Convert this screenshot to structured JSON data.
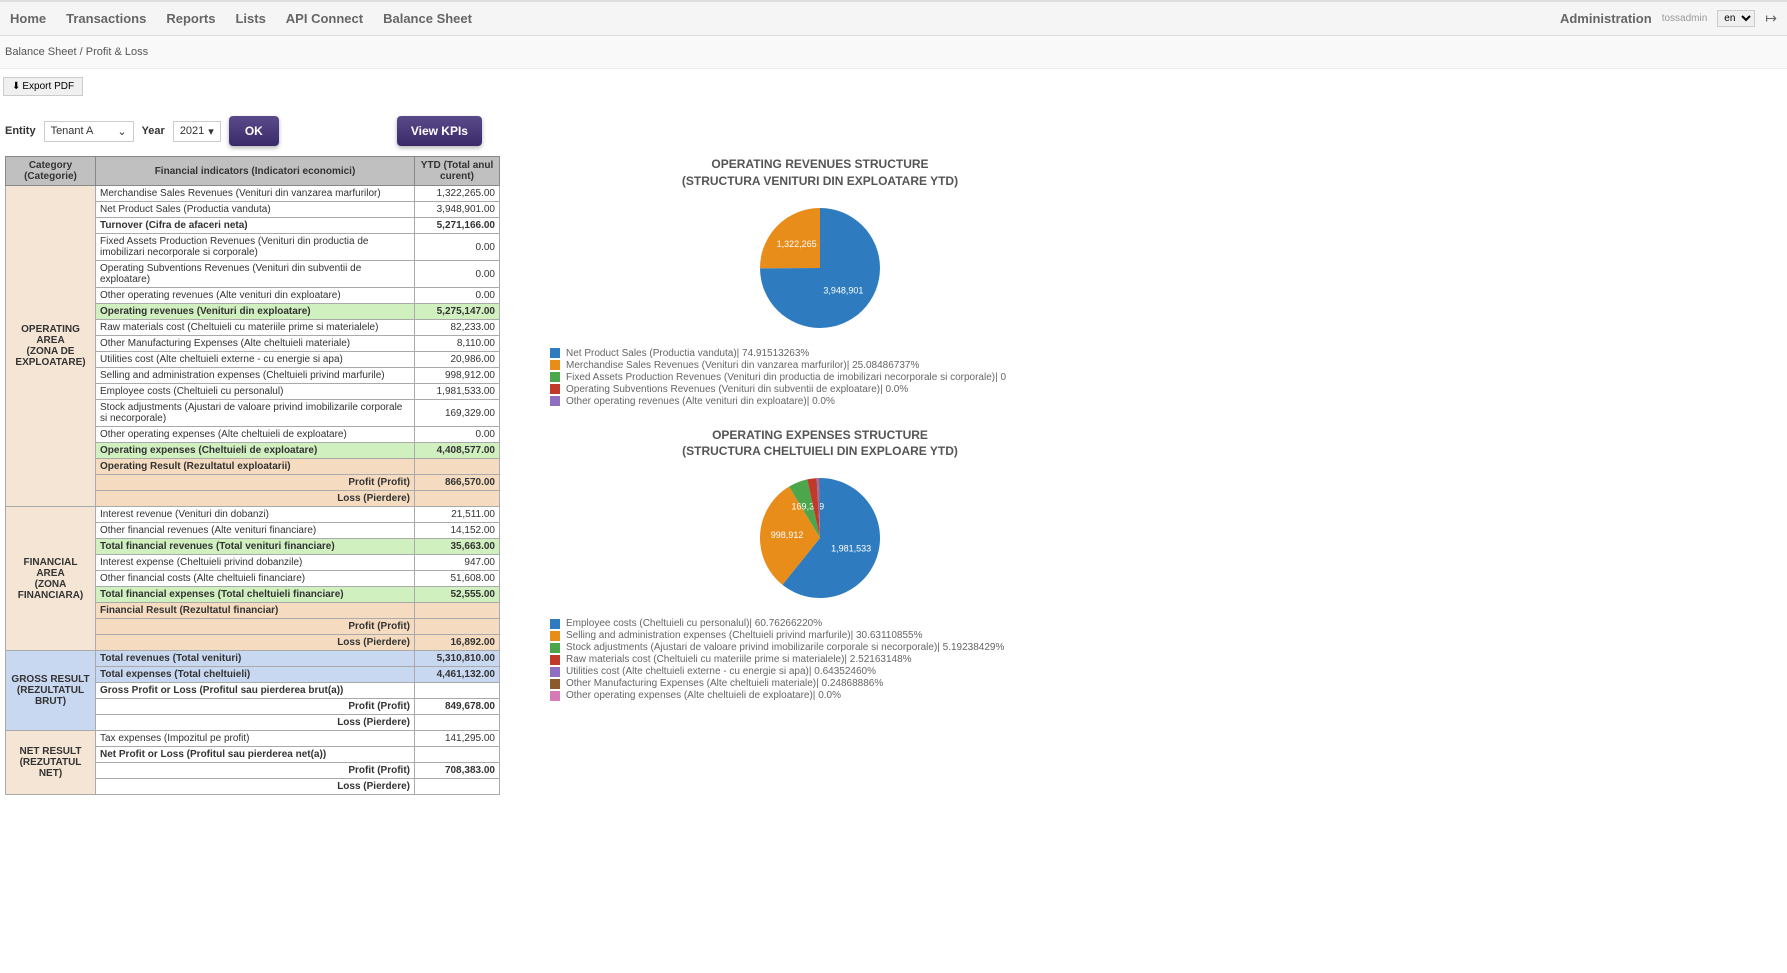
{
  "nav": {
    "items": [
      "Home",
      "Transactions",
      "Reports",
      "Lists",
      "API Connect",
      "Balance Sheet"
    ],
    "admin": "Administration",
    "user": "tossadmin",
    "lang": "en"
  },
  "breadcrumb": {
    "a": "Balance Sheet",
    "sep": " / ",
    "b": "Profit & Loss"
  },
  "export_label": "Export PDF",
  "controls": {
    "entity_label": "Entity",
    "entity_value": "Tenant A",
    "year_label": "Year",
    "year_value": "2021",
    "ok": "OK",
    "kpi": "View KPIs"
  },
  "table": {
    "h_cat": "Category (Categorie)",
    "h_ind": "Financial indicators (Indicatori economici)",
    "h_ytd": "YTD (Total anul curent)",
    "sections": [
      {
        "cat_line1": "OPERATING AREA",
        "cat_line2": "(ZONA DE EXPLOATARE)",
        "rows": [
          {
            "label": "Merchandise Sales Revenues (Venituri din vanzarea marfurilor)",
            "val": "1,322,265.00"
          },
          {
            "label": "Net Product Sales (Productia vanduta)",
            "val": "3,948,901.00"
          },
          {
            "label": "Turnover (Cifra de afaceri neta)",
            "val": "5,271,166.00",
            "style": "bold"
          },
          {
            "label": "Fixed Assets Production Revenues (Venituri din productia de imobilizari necorporale si corporale)",
            "val": "0.00"
          },
          {
            "label": "Operating Subventions Revenues (Venituri din subventii de exploatare)",
            "val": "0.00"
          },
          {
            "label": "Other operating revenues (Alte venituri din exploatare)",
            "val": "0.00"
          },
          {
            "label": "Operating revenues (Venituri din exploatare)",
            "val": "5,275,147.00",
            "style": "green"
          },
          {
            "label": "Raw materials cost (Cheltuieli cu materiile prime si materialele)",
            "val": "82,233.00"
          },
          {
            "label": "Other Manufacturing Expenses (Alte cheltuieli materiale)",
            "val": "8,110.00"
          },
          {
            "label": "Utilities cost (Alte cheltuieli externe - cu energie si apa)",
            "val": "20,986.00"
          },
          {
            "label": "Selling and administration expenses (Cheltuieli privind marfurile)",
            "val": "998,912.00"
          },
          {
            "label": "Employee costs (Cheltuieli cu personalul)",
            "val": "1,981,533.00"
          },
          {
            "label": "Stock adjustments (Ajustari de valoare privind imobilizarile corporale si necorporale)",
            "val": "169,329.00"
          },
          {
            "label": "Other operating expenses (Alte cheltuieli de exploatare)",
            "val": "0.00"
          },
          {
            "label": "Operating expenses (Cheltuieli de exploatare)",
            "val": "4,408,577.00",
            "style": "green"
          },
          {
            "label": "Operating Result (Rezultatul exploatarii)",
            "val": "",
            "style": "peach-bold"
          },
          {
            "rlabel": "Profit (Profit)",
            "val": "866,570.00",
            "style": "peach-bold"
          },
          {
            "rlabel": "Loss (Pierdere)",
            "val": "",
            "style": "peach-bold"
          }
        ]
      },
      {
        "cat_line1": "FINANCIAL AREA",
        "cat_line2": "(ZONA FINANCIARA)",
        "rows": [
          {
            "label": "Interest revenue (Venituri din dobanzi)",
            "val": "21,511.00"
          },
          {
            "label": "Other financial revenues (Alte venituri financiare)",
            "val": "14,152.00"
          },
          {
            "label": "Total financial revenues (Total venituri financiare)",
            "val": "35,663.00",
            "style": "green"
          },
          {
            "label": "Interest expense (Cheltuieli privind dobanzile)",
            "val": "947.00"
          },
          {
            "label": "Other financial costs (Alte cheltuieli financiare)",
            "val": "51,608.00"
          },
          {
            "label": "Total financial expenses (Total cheltuieli financiare)",
            "val": "52,555.00",
            "style": "green"
          },
          {
            "label": "Financial Result (Rezultatul financiar)",
            "val": "",
            "style": "peach-bold"
          },
          {
            "rlabel": "Profit (Profit)",
            "val": "",
            "style": "peach"
          },
          {
            "rlabel": "Loss (Pierdere)",
            "val": "16,892.00",
            "style": "peach-bold"
          }
        ]
      },
      {
        "cat_line1": "GROSS RESULT",
        "cat_line2": "(REZULTATUL BRUT)",
        "rows": [
          {
            "label": "Total revenues (Total venituri)",
            "val": "5,310,810.00",
            "style": "blue"
          },
          {
            "label": "Total expenses (Total cheltuieli)",
            "val": "4,461,132.00",
            "style": "blue"
          },
          {
            "label": "Gross Profit or Loss (Profitul sau pierderea brut(a))",
            "val": "",
            "style": "bold"
          },
          {
            "rlabel": "Profit (Profit)",
            "val": "849,678.00",
            "style": "bold"
          },
          {
            "rlabel": "Loss (Pierdere)",
            "val": ""
          }
        ]
      },
      {
        "cat_line1": "NET RESULT",
        "cat_line2": "(REZUTATUL NET)",
        "rows": [
          {
            "label": "Tax expenses (Impozitul pe profit)",
            "val": "141,295.00"
          },
          {
            "label": "Net Profit or Loss (Profitul sau pierderea net(a))",
            "val": "",
            "style": "bold"
          },
          {
            "rlabel": "Profit (Profit)",
            "val": "708,383.00",
            "style": "bold"
          },
          {
            "rlabel": "Loss (Pierdere)",
            "val": ""
          }
        ]
      }
    ]
  },
  "chart_data": [
    {
      "type": "pie",
      "title_l1": "OPERATING REVENUES STRUCTURE",
      "title_l2": "(STRUCTURA VENITURI DIN EXPLOATARE YTD)",
      "slices": [
        {
          "label": "Net Product Sales (Productia vanduta)| 74.91513263%",
          "value": 3948901,
          "color": "#2e7cbf",
          "datalabel": "3,948,901"
        },
        {
          "label": "Merchandise Sales Revenues (Venituri din vanzarea marfurilor)| 25.08486737%",
          "value": 1322265,
          "color": "#e88c1a",
          "datalabel": "1,322,265"
        },
        {
          "label": "Fixed Assets Production Revenues (Venituri din productia de imobilizari necorporale si corporale)| 0",
          "value": 0,
          "color": "#4ca64c"
        },
        {
          "label": "Operating Subventions Revenues (Venituri din subventii de exploatare)| 0.0%",
          "value": 0,
          "color": "#c0392b"
        },
        {
          "label": "Other operating revenues (Alte venituri din exploatare)| 0.0%",
          "value": 0,
          "color": "#8e6fc1"
        }
      ]
    },
    {
      "type": "pie",
      "title_l1": "OPERATING EXPENSES STRUCTURE",
      "title_l2": "(STRUCTURA CHELTUIELI DIN EXPLOARE YTD)",
      "slices": [
        {
          "label": "Employee costs (Cheltuieli cu personalul)| 60.76266220%",
          "value": 1981533,
          "color": "#2e7cbf",
          "datalabel": "1,981,533"
        },
        {
          "label": "Selling and administration expenses (Cheltuieli privind marfurile)| 30.63110855%",
          "value": 998912,
          "color": "#e88c1a",
          "datalabel": "998,912"
        },
        {
          "label": "Stock adjustments (Ajustari de valoare privind imobilizarile corporale si necorporale)| 5.19238429%",
          "value": 169329,
          "color": "#4ca64c",
          "datalabel": "169,329"
        },
        {
          "label": "Raw materials cost (Cheltuieli cu materiile prime si materialele)| 2.52163148%",
          "value": 82233,
          "color": "#c0392b"
        },
        {
          "label": "Utilities cost (Alte cheltuieli externe - cu energie si apa)| 0.64352460%",
          "value": 20986,
          "color": "#8e6fc1"
        },
        {
          "label": "Other Manufacturing Expenses (Alte cheltuieli materiale)| 0.24868886%",
          "value": 8110,
          "color": "#8b5a2b"
        },
        {
          "label": "Other operating expenses (Alte cheltuieli de exploatare)| 0.0%",
          "value": 0,
          "color": "#d67bb8"
        }
      ]
    }
  ]
}
